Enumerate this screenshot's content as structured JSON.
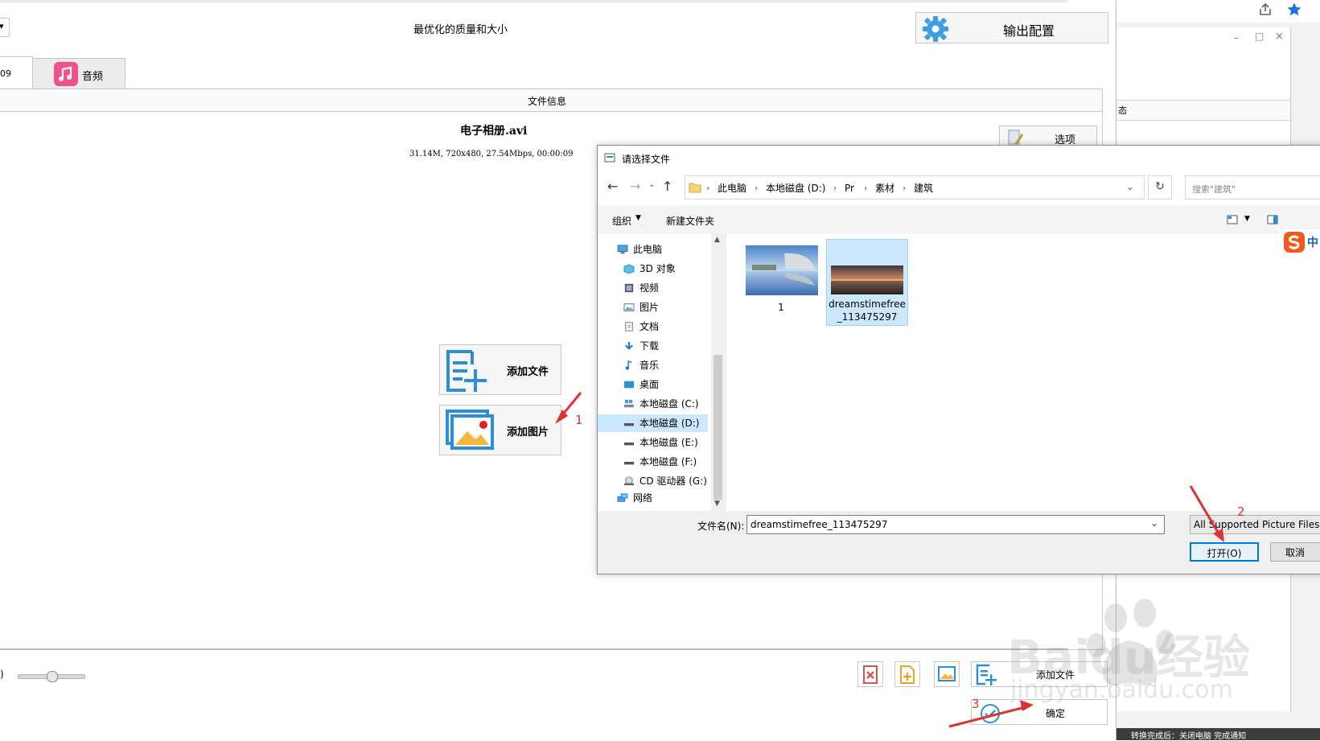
{
  "main": {
    "dropdown_partial": "▾",
    "quality_text": "最优化的质量和大小",
    "output_config_label": "输出配置",
    "tab_video_partial": "09",
    "tab_audio_label": "音频",
    "file_info_header": "文件信息",
    "file_name": "电子相册.avi",
    "file_meta": "31.14M, 720x480, 27.54Mbps, 00:00:09",
    "options_label": "选项",
    "add_file_label": "添加文件",
    "add_image_label": "添加图片",
    "bottom_add_file_label": "添加文件",
    "ok_label": "确定",
    "left_edge_partial": ")"
  },
  "right_panel": {
    "header_partial": "态",
    "minimize_glyph": "–",
    "maximize_glyph": "□",
    "close_glyph": "×",
    "bottom_text_partial": "转换完成后：关闭电脑  完成通知"
  },
  "dialog": {
    "title": "请选择文件",
    "breadcrumb": [
      "此电脑",
      "本地磁盘 (D:)",
      "Pr",
      "素材",
      "建筑"
    ],
    "search_placeholder": "搜索\"建筑\"",
    "organize_label": "组织",
    "new_folder_label": "新建文件夹",
    "tree": [
      {
        "label": "此电脑",
        "icon": "computer-icon",
        "level": 0
      },
      {
        "label": "3D 对象",
        "icon": "cube-icon",
        "level": 1
      },
      {
        "label": "视频",
        "icon": "film-icon",
        "level": 1
      },
      {
        "label": "图片",
        "icon": "picture-icon",
        "level": 1
      },
      {
        "label": "文档",
        "icon": "document-icon",
        "level": 1
      },
      {
        "label": "下载",
        "icon": "download-icon",
        "level": 1
      },
      {
        "label": "音乐",
        "icon": "music-icon",
        "level": 1
      },
      {
        "label": "桌面",
        "icon": "desktop-icon",
        "level": 1
      },
      {
        "label": "本地磁盘 (C:)",
        "icon": "drive-icon",
        "level": 1
      },
      {
        "label": "本地磁盘 (D:)",
        "icon": "drive-icon",
        "level": 1,
        "selected": true
      },
      {
        "label": "本地磁盘 (E:)",
        "icon": "drive-icon",
        "level": 1
      },
      {
        "label": "本地磁盘 (F:)",
        "icon": "drive-icon",
        "level": 1
      },
      {
        "label": "CD 驱动器 (G:)",
        "icon": "cd-drive-icon",
        "level": 1
      },
      {
        "label": "网络",
        "icon": "network-icon",
        "level": 0
      }
    ],
    "files": [
      {
        "name": "1"
      },
      {
        "name": "dreamstimefree_113475297",
        "selected": true
      }
    ],
    "filename_label": "文件名(N):",
    "filename_value": "dreamstimefree_113475297",
    "filetype_value": "All Supported Picture Files",
    "open_label": "打开(O)",
    "cancel_label": "取消",
    "ime_badge": "中"
  },
  "annotations": {
    "step1": "1",
    "step2": "2",
    "step3": "3"
  },
  "watermark": {
    "brand": "Baidu经验",
    "url": "jingyan.baidu.com"
  },
  "colors": {
    "accent": "#2f8fd8",
    "music_pink": "#f0508c",
    "selection": "#cce8ff",
    "annotation_red": "#e03131"
  }
}
